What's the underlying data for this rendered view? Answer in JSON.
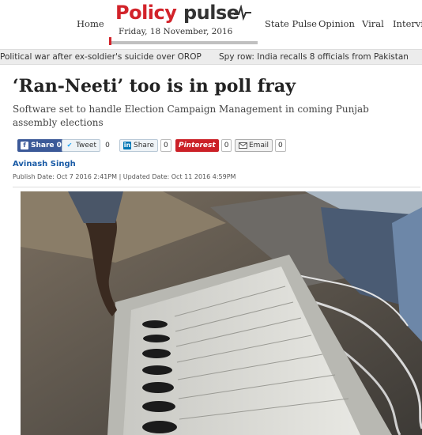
{
  "header": {
    "nav_left": "Home",
    "logo_policy": "Policy",
    "logo_pulse": "pulse",
    "date": "Friday, 18 November, 2016",
    "nav_right": [
      "State Pulse",
      "Opinion",
      "Viral",
      "Intervie"
    ]
  },
  "ticker": {
    "items": [
      "Political war after ex-soldier's suicide over OROP",
      "Spy row: India recalls 8 officials from Pakistan"
    ]
  },
  "article": {
    "headline": "‘Ran-Neeti’ too is in poll fray",
    "subhead": "Software set to handle Election Campaign Management in coming Punjab assembly elections",
    "author": "Avinash Singh",
    "publish_line": "Publish Date: Oct 7 2016 2:41PM | Updated Date: Oct 11 2016 4:59PM"
  },
  "share": {
    "facebook": {
      "label": "Share 0"
    },
    "twitter": {
      "label": "Tweet",
      "count": "0"
    },
    "linkedin": {
      "label": "Share",
      "count": "0"
    },
    "pinterest": {
      "label": "Pinterest",
      "count": "0"
    },
    "email": {
      "label": "Email",
      "count": "0"
    }
  },
  "colors": {
    "brand_red": "#d2232a",
    "author_blue": "#1a5ba6",
    "facebook": "#3b5998",
    "pinterest": "#cb2027"
  }
}
